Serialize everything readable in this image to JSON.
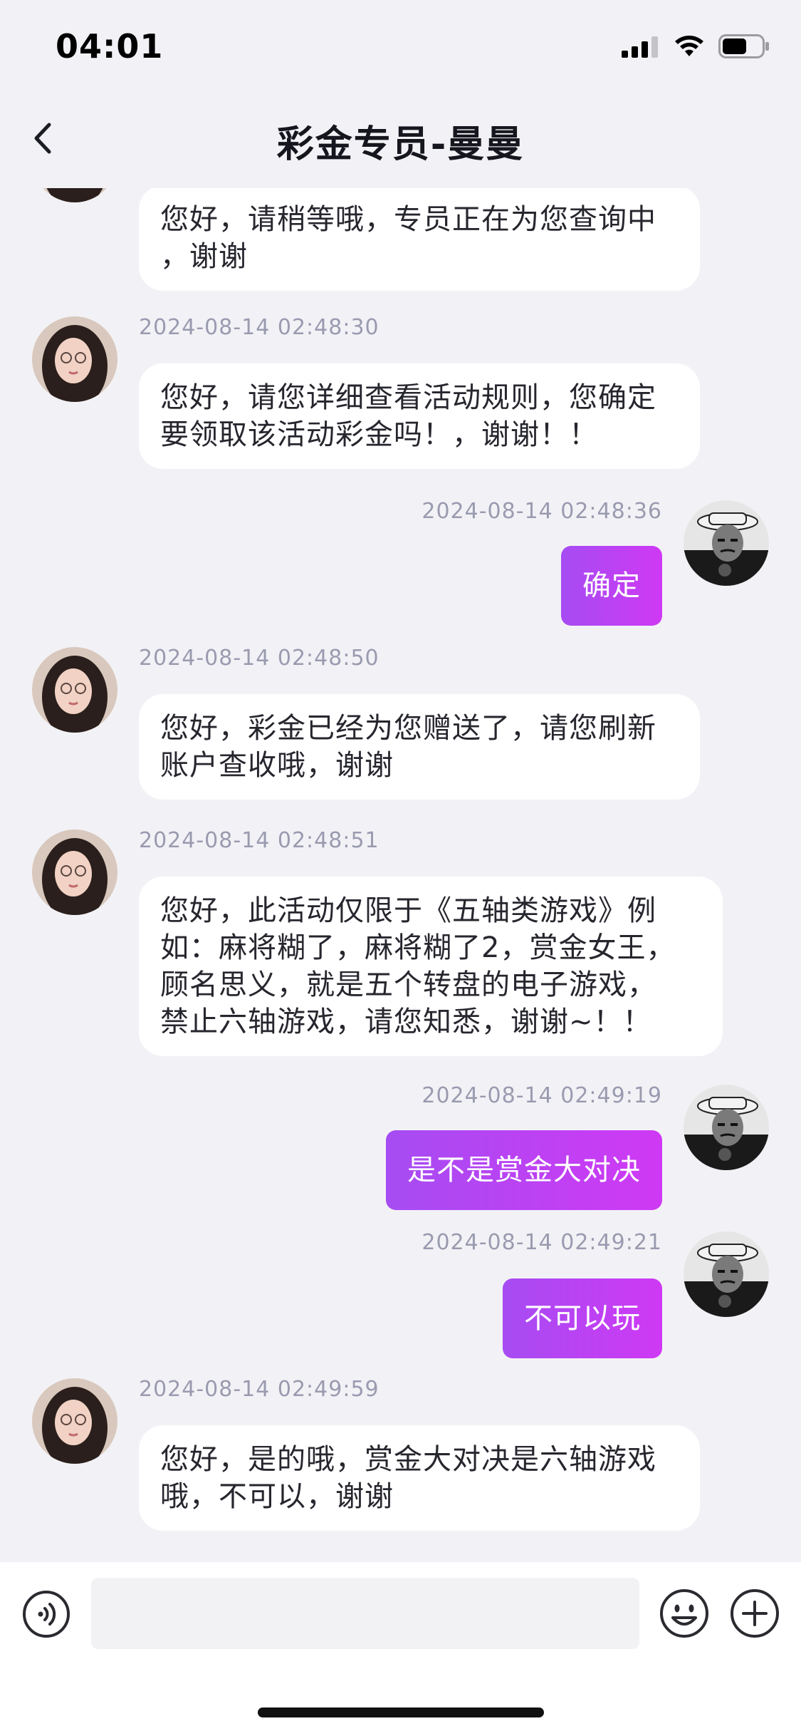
{
  "status_bar": {
    "time": "04:01"
  },
  "nav": {
    "title": "彩金专员-曼曼"
  },
  "messages": [
    {
      "side": "agent",
      "timestamp": "",
      "lines": [
        "您好，请稍等哦，专员正在为您查询中",
        "，谢谢"
      ]
    },
    {
      "side": "agent",
      "timestamp": "2024-08-14 02:48:30",
      "lines": [
        "您好，请您详细查看活动规则，您确定",
        "要领取该活动彩金吗！，谢谢！！"
      ]
    },
    {
      "side": "user",
      "timestamp": "2024-08-14 02:48:36",
      "text": "确定"
    },
    {
      "side": "agent",
      "timestamp": "2024-08-14 02:48:50",
      "lines": [
        "您好，彩金已经为您赠送了，请您刷新",
        "账户查收哦，谢谢"
      ]
    },
    {
      "side": "agent",
      "timestamp": "2024-08-14 02:48:51",
      "lines": [
        "您好，此活动仅限于《五轴类游戏》例",
        "如：麻将糊了，麻将糊了2，赏金女王，",
        "顾名思义，就是五个转盘的电子游戏，",
        "禁止六轴游戏，请您知悉，谢谢~！！"
      ]
    },
    {
      "side": "user",
      "timestamp": "2024-08-14 02:49:19",
      "text": "是不是赏金大对决"
    },
    {
      "side": "user",
      "timestamp": "2024-08-14 02:49:21",
      "text": "不可以玩"
    },
    {
      "side": "agent",
      "timestamp": "2024-08-14 02:49:59",
      "lines": [
        "您好，是的哦，赏金大对决是六轴游戏",
        "哦，不可以，谢谢"
      ]
    }
  ],
  "input": {
    "placeholder": ""
  },
  "colors": {
    "background": "#f2f2f6",
    "bubble_out_start": "#a64cf2",
    "bubble_out_end": "#cf39f4",
    "bubble_in": "#ffffff",
    "timestamp": "#9a9ab0"
  },
  "icons": {
    "back": "chevron-left-icon",
    "voice": "voice-icon",
    "emoji": "emoji-icon",
    "plus": "plus-icon"
  }
}
